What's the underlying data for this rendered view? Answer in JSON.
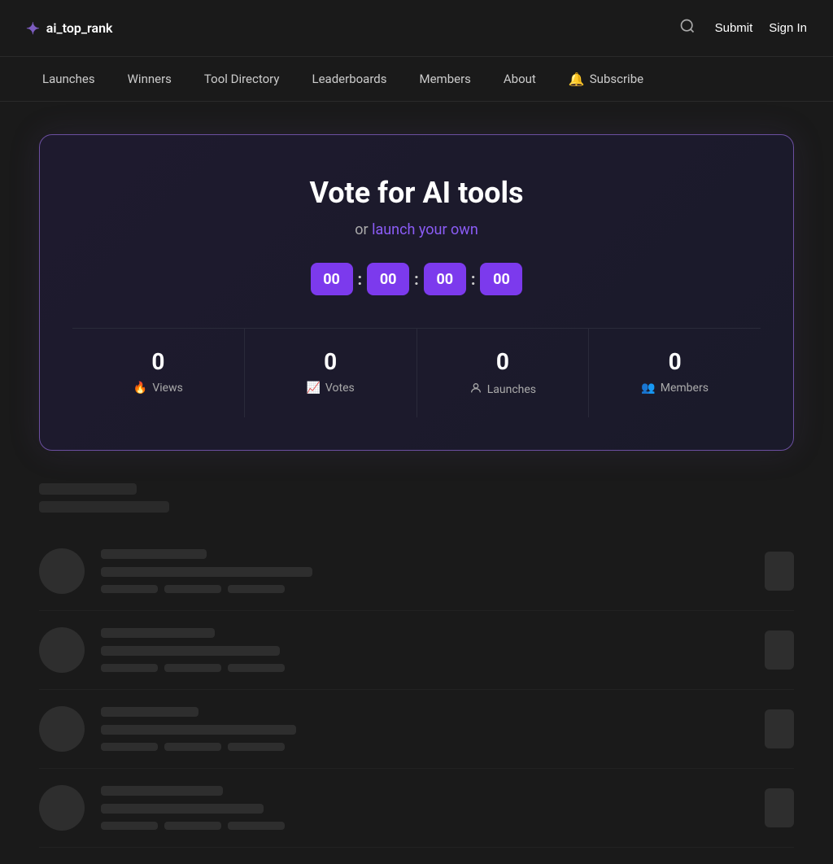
{
  "logo": {
    "icon": "✦",
    "text": "ai_top_rank"
  },
  "header": {
    "submit_label": "Submit",
    "signin_label": "Sign In"
  },
  "nav": {
    "items": [
      {
        "label": "Launches",
        "id": "launches"
      },
      {
        "label": "Winners",
        "id": "winners"
      },
      {
        "label": "Tool Directory",
        "id": "tool-directory"
      },
      {
        "label": "Leaderboards",
        "id": "leaderboards"
      },
      {
        "label": "Members",
        "id": "members"
      },
      {
        "label": "About",
        "id": "about"
      }
    ],
    "subscribe_label": "Subscribe"
  },
  "hero": {
    "title": "Vote for AI tools",
    "subtitle_text": "or",
    "subtitle_link": "launch your own",
    "countdown": {
      "hours": "00",
      "minutes": "00",
      "seconds": "00",
      "ms": "00"
    },
    "stats": [
      {
        "value": "0",
        "label": "Views",
        "icon": "🔥"
      },
      {
        "value": "0",
        "label": "Votes",
        "icon": "📈"
      },
      {
        "value": "0",
        "label": "Launches",
        "icon": "👤"
      },
      {
        "value": "0",
        "label": "Members",
        "icon": "👥"
      }
    ]
  }
}
